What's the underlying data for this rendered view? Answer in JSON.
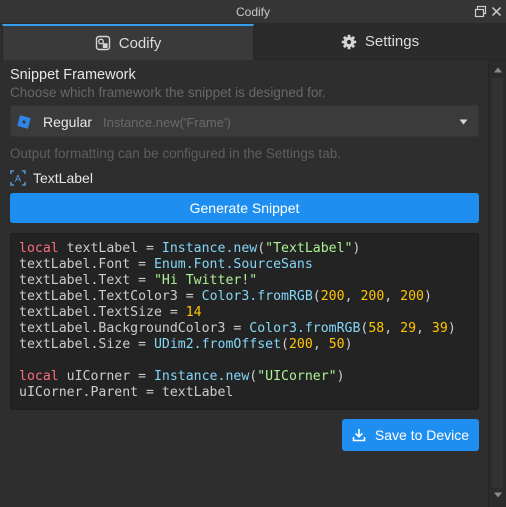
{
  "window": {
    "title": "Codify"
  },
  "tabs": [
    {
      "label": "Codify",
      "icon": "codify-icon",
      "active": true
    },
    {
      "label": "Settings",
      "icon": "gear-icon",
      "active": false
    }
  ],
  "framework": {
    "title": "Snippet Framework",
    "description": "Choose which framework the snippet is designed for.",
    "selected": "Regular",
    "hint": "Instance.new('Frame')",
    "icon": "roblox-logo-icon"
  },
  "output_note": "Output formatting can be configured in the Settings tab.",
  "selected_instance": {
    "name": "TextLabel",
    "icon": "textlabel-icon"
  },
  "generate_button": {
    "label": "Generate Snippet"
  },
  "code": {
    "lines": [
      [
        [
          "kw",
          "local"
        ],
        [
          "plain",
          " textLabel = "
        ],
        [
          "fn",
          "Instance.new"
        ],
        [
          "plain",
          "("
        ],
        [
          "str",
          "\"TextLabel\""
        ],
        [
          "plain",
          ")"
        ]
      ],
      [
        [
          "plain",
          "textLabel.Font = "
        ],
        [
          "fn",
          "Enum.Font.SourceSans"
        ]
      ],
      [
        [
          "plain",
          "textLabel.Text = "
        ],
        [
          "str",
          "\"Hi Twitter!\""
        ]
      ],
      [
        [
          "plain",
          "textLabel.TextColor3 = "
        ],
        [
          "fn",
          "Color3.fromRGB"
        ],
        [
          "plain",
          "("
        ],
        [
          "num",
          "200"
        ],
        [
          "plain",
          ", "
        ],
        [
          "num",
          "200"
        ],
        [
          "plain",
          ", "
        ],
        [
          "num",
          "200"
        ],
        [
          "plain",
          ")"
        ]
      ],
      [
        [
          "plain",
          "textLabel.TextSize = "
        ],
        [
          "num",
          "14"
        ]
      ],
      [
        [
          "plain",
          "textLabel.BackgroundColor3 = "
        ],
        [
          "fn",
          "Color3.fromRGB"
        ],
        [
          "plain",
          "("
        ],
        [
          "num",
          "58"
        ],
        [
          "plain",
          ", "
        ],
        [
          "num",
          "29"
        ],
        [
          "plain",
          ", "
        ],
        [
          "num",
          "39"
        ],
        [
          "plain",
          ")"
        ]
      ],
      [
        [
          "plain",
          "textLabel.Size = "
        ],
        [
          "fn",
          "UDim2.fromOffset"
        ],
        [
          "plain",
          "("
        ],
        [
          "num",
          "200"
        ],
        [
          "plain",
          ", "
        ],
        [
          "num",
          "50"
        ],
        [
          "plain",
          ")"
        ]
      ],
      [],
      [
        [
          "kw",
          "local"
        ],
        [
          "plain",
          " uICorner = "
        ],
        [
          "fn",
          "Instance.new"
        ],
        [
          "plain",
          "("
        ],
        [
          "str",
          "\"UICorner\""
        ],
        [
          "plain",
          ")"
        ]
      ],
      [
        [
          "plain",
          "uICorner.Parent = textLabel"
        ]
      ]
    ]
  },
  "save_button": {
    "label": "Save to Device",
    "icon": "download-icon"
  },
  "colors": {
    "accent": "#1e8ff0",
    "tab_indicator": "#36a0f0",
    "keyword": "#f86d7c",
    "function": "#84d6f7",
    "string": "#adf195",
    "number": "#ffc600"
  }
}
